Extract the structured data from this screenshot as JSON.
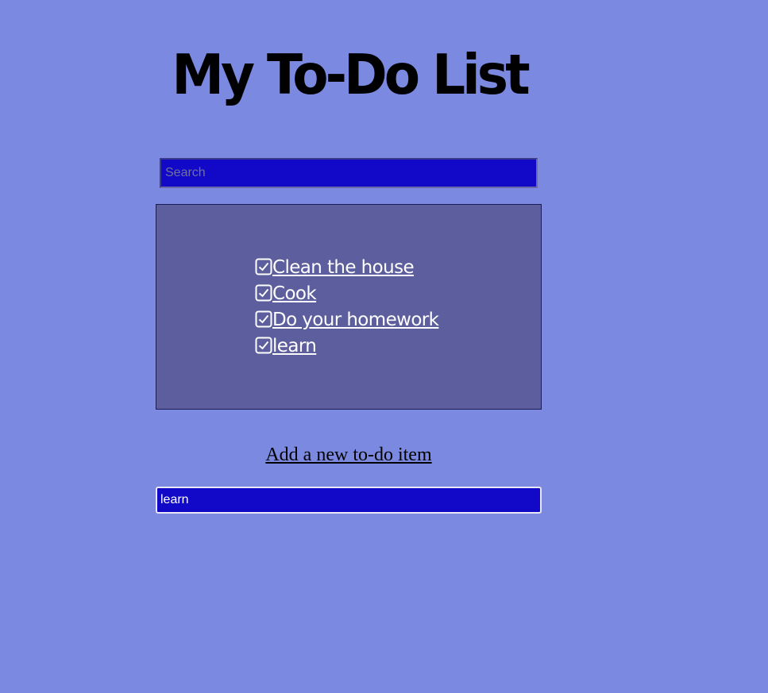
{
  "page": {
    "title": "My To-Do List"
  },
  "search": {
    "placeholder": "Search",
    "value": ""
  },
  "todos": [
    {
      "label": "Clean the house",
      "icon": "checkbox-checked-icon"
    },
    {
      "label": "Cook",
      "icon": "checkbox-checked-icon"
    },
    {
      "label": "Do your homework",
      "icon": "checkbox-checked-icon"
    },
    {
      "label": "learn",
      "icon": "checkbox-checked-icon"
    }
  ],
  "add": {
    "link_label": "Add a new to-do item",
    "input_value": "learn"
  },
  "colors": {
    "background": "#7b8ae0",
    "input_background": "#1209c8",
    "list_panel": "#5c5e9e",
    "item_text": "#ffffff"
  }
}
